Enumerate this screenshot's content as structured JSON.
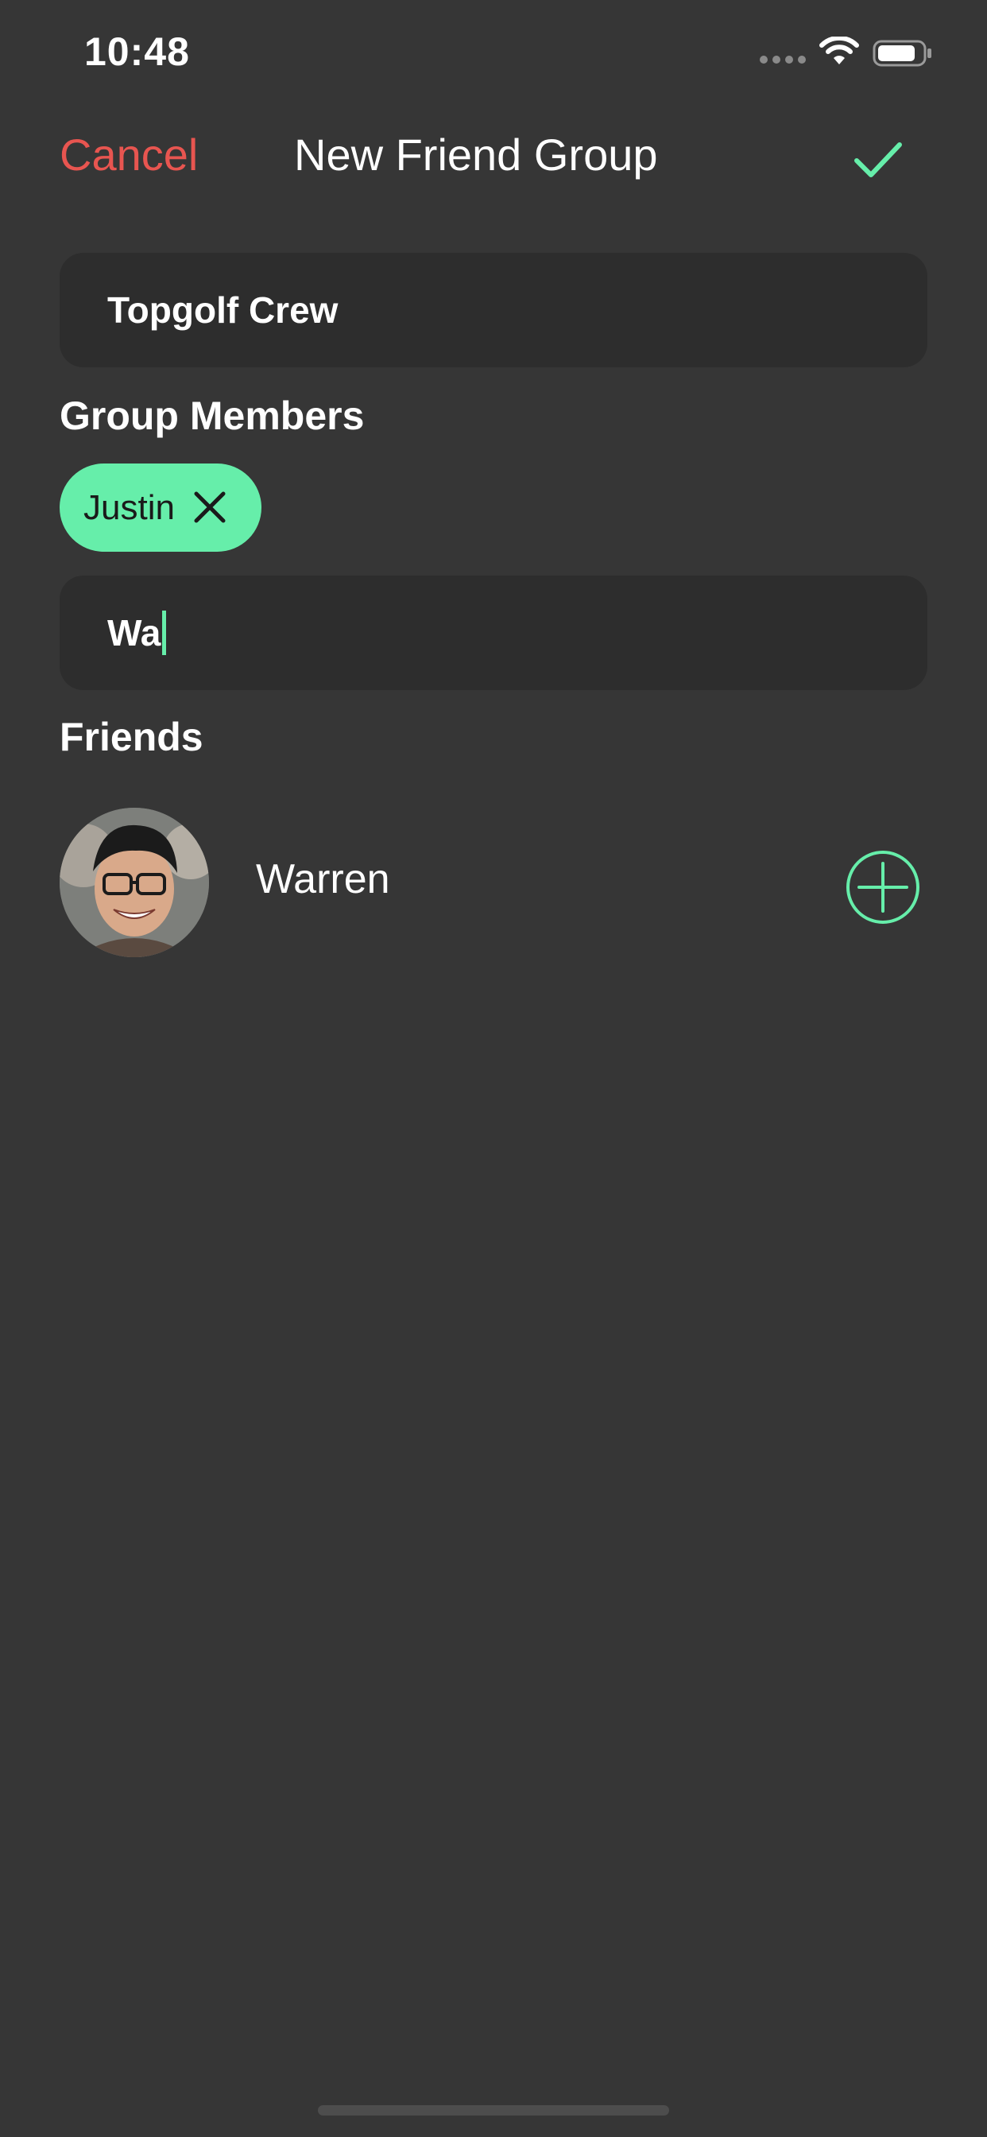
{
  "status_bar": {
    "time": "10:48",
    "icons": [
      "signal-icon",
      "wifi-icon",
      "battery-icon"
    ]
  },
  "header": {
    "cancel_label": "Cancel",
    "title": "New Friend Group",
    "done_icon": "checkmark-icon"
  },
  "group_name": {
    "value": "Topgolf Crew"
  },
  "members": {
    "heading": "Group Members",
    "chips": [
      {
        "label": "Justin",
        "remove_icon": "close-icon"
      }
    ]
  },
  "search": {
    "value": "Wa"
  },
  "friends": {
    "heading": "Friends",
    "items": [
      {
        "name": "Warren",
        "action_icon": "add-circle-icon"
      }
    ]
  },
  "colors": {
    "background": "#363636",
    "field_background": "#2d2d2d",
    "accent": "#66eeaa",
    "cancel": "#e85550"
  }
}
